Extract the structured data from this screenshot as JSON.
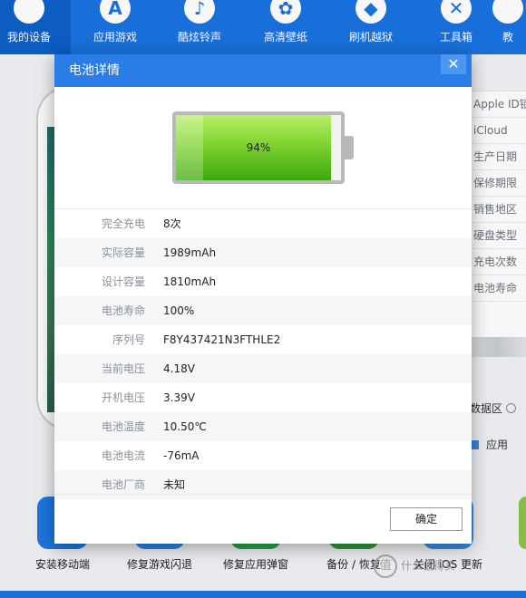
{
  "topbar": {
    "items": [
      {
        "label": "我的设备",
        "icon": "apple-icon",
        "glyph": ""
      },
      {
        "label": "应用游戏",
        "icon": "app-store-icon",
        "glyph": "A"
      },
      {
        "label": "酷炫铃声",
        "icon": "bell-icon",
        "glyph": "♪"
      },
      {
        "label": "高清壁纸",
        "icon": "flower-icon",
        "glyph": "✿"
      },
      {
        "label": "刷机越狱",
        "icon": "box-icon",
        "glyph": "◆"
      },
      {
        "label": "工具箱",
        "icon": "tools-icon",
        "glyph": "✕"
      },
      {
        "label": "教",
        "icon": "tutorial-icon",
        "glyph": ""
      }
    ]
  },
  "background": {
    "info_rows": [
      "Apple ID锁",
      "iCloud",
      "生产日期",
      "保修期限",
      "销售地区",
      "硬盘类型",
      "充电次数",
      "电池寿命"
    ],
    "data_area": "数据区",
    "legend_app": "应用",
    "tools": [
      "安装移动端",
      "修复游戏闪退",
      "修复应用弹窗",
      "备份 / 恢复",
      "关闭 iOS 更新"
    ],
    "watermark": "什么值得买"
  },
  "modal": {
    "title": "电池详情",
    "close_glyph": "✕",
    "battery_percent": "94%",
    "battery_level": 0.94,
    "details": [
      {
        "label": "完全充电",
        "value": "8次"
      },
      {
        "label": "实际容量",
        "value": "1989mAh"
      },
      {
        "label": "设计容量",
        "value": "1810mAh"
      },
      {
        "label": "电池寿命",
        "value": "100%"
      },
      {
        "label": "序列号",
        "value": "F8Y437421N3FTHLE2"
      },
      {
        "label": "当前电压",
        "value": "4.18V"
      },
      {
        "label": "开机电压",
        "value": "3.39V"
      },
      {
        "label": "电池温度",
        "value": "10.50℃"
      },
      {
        "label": "电池电流",
        "value": "-76mA"
      },
      {
        "label": "电池厂商",
        "value": "未知"
      }
    ],
    "ok_label": "确定"
  },
  "colors": {
    "brand_blue": "#1a73e0",
    "battery_green": "#6cc623"
  }
}
